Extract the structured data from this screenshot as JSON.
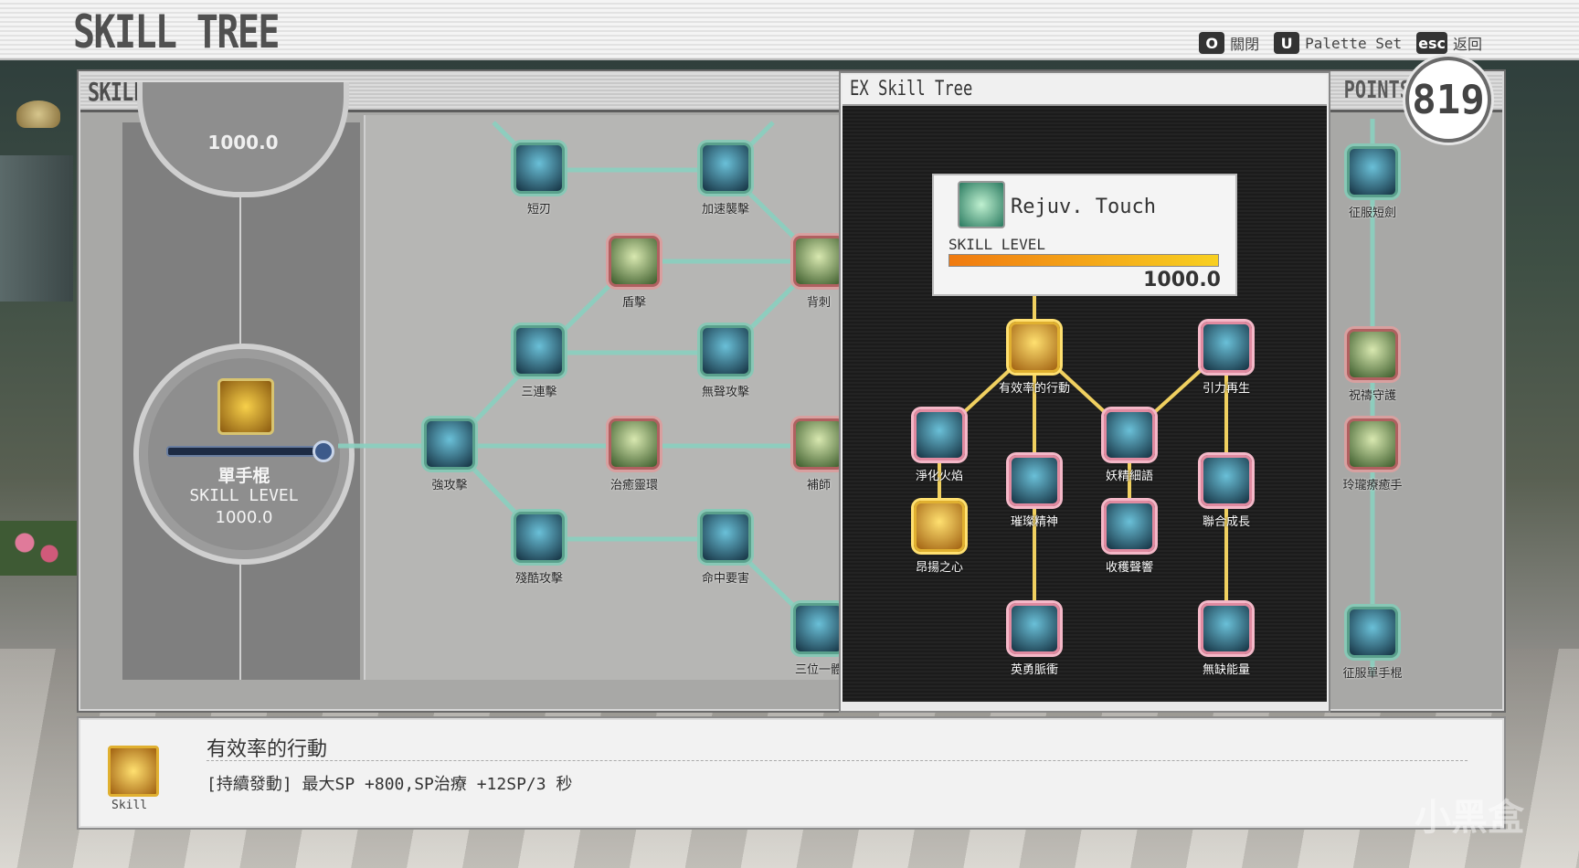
{
  "header": {
    "title": "SKILL TREE"
  },
  "keys": [
    {
      "key": "O",
      "label": "關閉"
    },
    {
      "key": "U",
      "label": "Palette Set"
    },
    {
      "key": "esc",
      "label": "返回"
    }
  ],
  "panel": {
    "title": "SKILL TREE",
    "points_label": "POINTS",
    "points_value": "819"
  },
  "weapon": {
    "top_value": "1000.0",
    "name": "單手棍",
    "skill_level_label": "SKILL LEVEL",
    "value": "1000.0"
  },
  "tree_nodes": [
    {
      "name": "短刃"
    },
    {
      "name": "加速襲擊"
    },
    {
      "name": "盾擊"
    },
    {
      "name": "背刺"
    },
    {
      "name": "三連擊"
    },
    {
      "name": "無聲攻擊"
    },
    {
      "name": "強攻擊"
    },
    {
      "name": "治癒靈環"
    },
    {
      "name": "補師"
    },
    {
      "name": "殘酷攻擊"
    },
    {
      "name": "命中要害"
    },
    {
      "name": "三位一體"
    }
  ],
  "right_nodes": [
    {
      "name": "征服短劍"
    },
    {
      "name": "祝禱守護"
    },
    {
      "name": "玲瓏療癒手"
    },
    {
      "name": "征服單手棍"
    }
  ],
  "ex": {
    "title": "EX Skill Tree",
    "tooltip": {
      "name": "Rejuv. Touch",
      "skill_level_label": "SKILL LEVEL",
      "value": "1000.0",
      "level": 1.0
    },
    "nodes": [
      {
        "name": "有效率的行動"
      },
      {
        "name": "引力再生"
      },
      {
        "name": "淨化火焰"
      },
      {
        "name": "妖精細語"
      },
      {
        "name": "璀璨精神"
      },
      {
        "name": "聯合成長"
      },
      {
        "name": "昂揚之心"
      },
      {
        "name": "收穫聲響"
      },
      {
        "name": "英勇脈衝"
      },
      {
        "name": "無缺能量"
      }
    ]
  },
  "description": {
    "icon_label": "Skill",
    "title": "有效率的行動",
    "text": "[持續發動] 最大SP +800,SP治療 +12SP/3 秒"
  },
  "watermark": "小黑盒",
  "colors": {
    "panel": "#a8a8a6",
    "ex_bg": "#1d1d1d",
    "link_teal": "#8ad0c0",
    "link_gold": "#f0d060"
  }
}
